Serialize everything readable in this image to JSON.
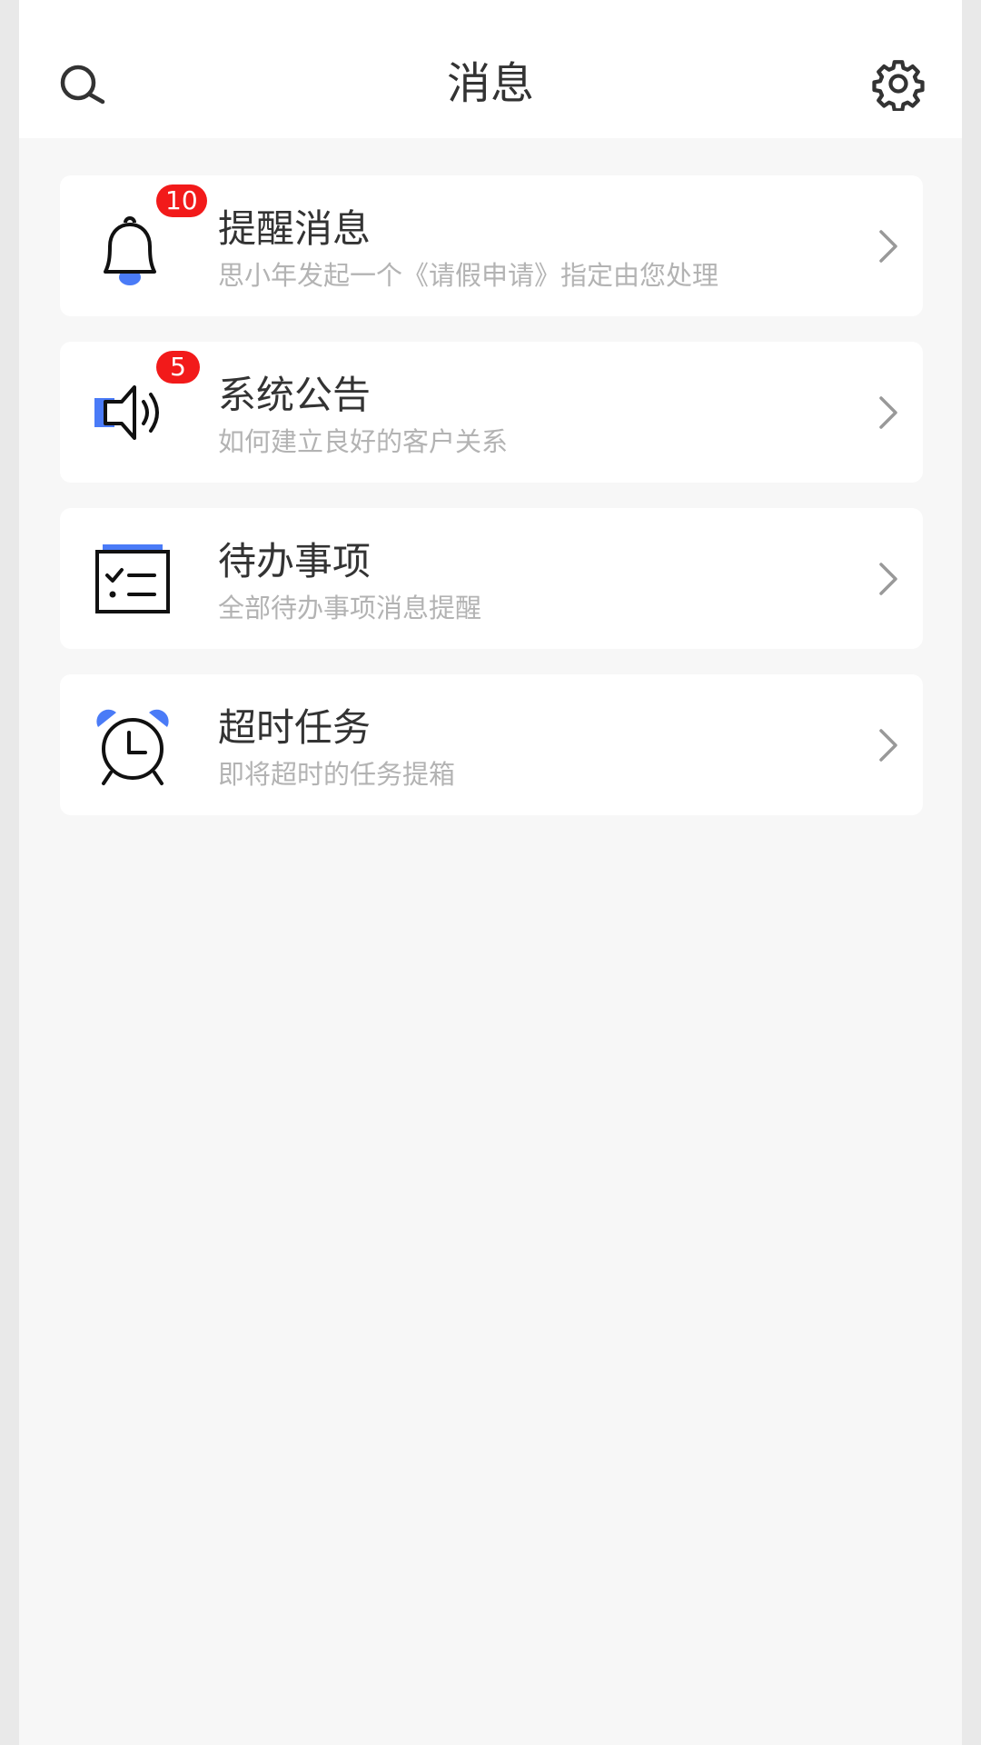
{
  "header": {
    "title": "消息",
    "search_icon": "search-icon",
    "settings_icon": "gear-icon"
  },
  "colors": {
    "accent": "#4a7bf7",
    "badge": "#f21a1a",
    "title_text": "#333333",
    "subtitle_text": "#b3b3b3",
    "background": "#f7f7f7"
  },
  "messages": [
    {
      "title": "提醒消息",
      "subtitle": "思小年发起一个《请假申请》指定由您处理",
      "badge": "10",
      "icon": "bell-icon"
    },
    {
      "title": "系统公告",
      "subtitle": "如何建立良好的客户关系",
      "badge": "5",
      "icon": "speaker-icon"
    },
    {
      "title": "待办事项",
      "subtitle": "全部待办事项消息提醒",
      "badge": null,
      "icon": "todo-list-icon"
    },
    {
      "title": "超时任务",
      "subtitle": "即将超时的任务提箱",
      "badge": null,
      "icon": "alarm-clock-icon"
    }
  ]
}
